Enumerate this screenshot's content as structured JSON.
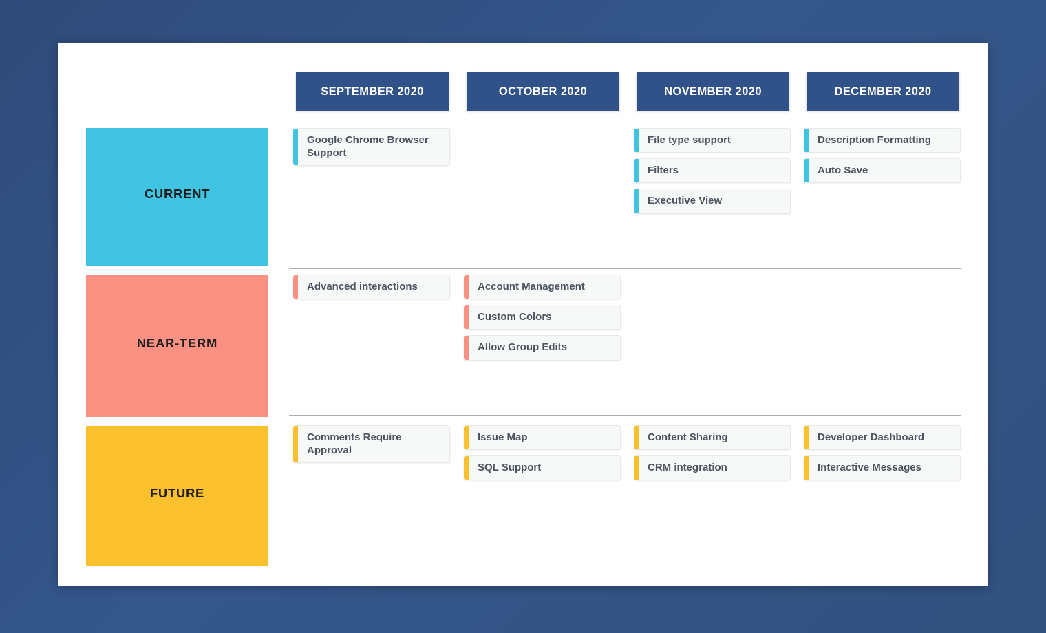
{
  "page": {
    "background_color": "#325183",
    "panel_color": "#ffffff"
  },
  "columns": [
    {
      "label": "SEPTEMBER 2020"
    },
    {
      "label": "OCTOBER 2020"
    },
    {
      "label": "NOVEMBER 2020"
    },
    {
      "label": "DECEMBER 2020"
    }
  ],
  "header_color": "#315288",
  "rows": [
    {
      "label": "CURRENT",
      "color": "#41c3e2",
      "cells": [
        {
          "items": [
            "Google Chrome Browser Support"
          ]
        },
        {
          "items": []
        },
        {
          "items": [
            "File type support",
            "Filters",
            "Executive View"
          ]
        },
        {
          "items": [
            "Description Formatting",
            "Auto Save"
          ]
        }
      ]
    },
    {
      "label": "NEAR-TERM",
      "color": "#fa9183",
      "cells": [
        {
          "items": [
            "Advanced interactions"
          ]
        },
        {
          "items": [
            "Account Management",
            "Custom Colors",
            "Allow Group Edits"
          ]
        },
        {
          "items": []
        },
        {
          "items": []
        }
      ]
    },
    {
      "label": "FUTURE",
      "color": "#fbc02e",
      "cells": [
        {
          "items": [
            "Comments Require Approval"
          ]
        },
        {
          "items": [
            "Issue Map",
            "SQL Support"
          ]
        },
        {
          "items": [
            "Content Sharing",
            "CRM integration"
          ]
        },
        {
          "items": [
            "Developer Dashboard",
            "Interactive Messages"
          ]
        }
      ]
    }
  ]
}
